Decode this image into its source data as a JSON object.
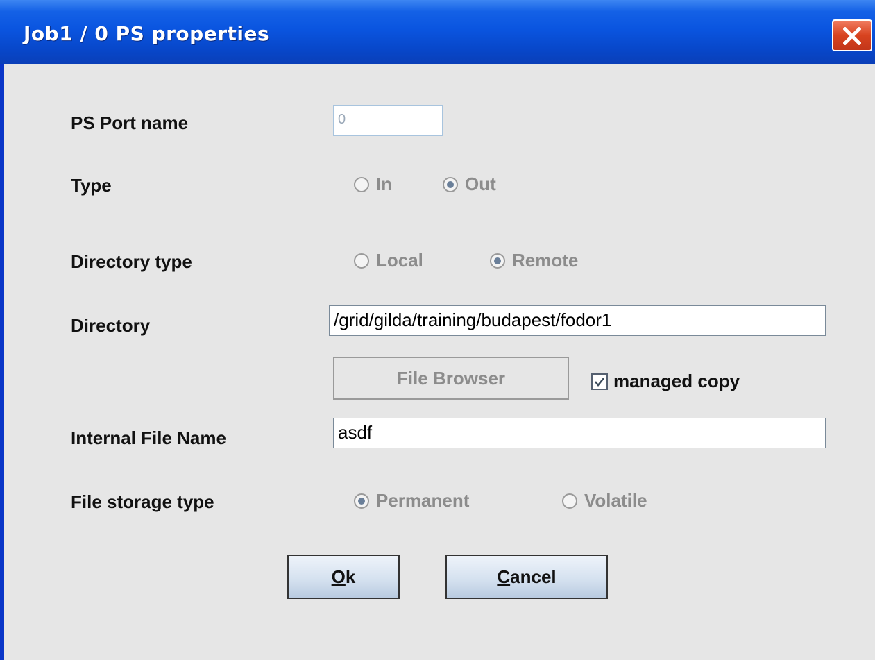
{
  "window": {
    "title": "Job1 / 0 PS properties"
  },
  "form": {
    "port_name": {
      "label": "PS Port name",
      "value": "0"
    },
    "type": {
      "label": "Type",
      "options": [
        "In",
        "Out"
      ],
      "selected": "Out"
    },
    "directory_type": {
      "label": "Directory type",
      "options": [
        "Local",
        "Remote"
      ],
      "selected": "Remote"
    },
    "directory": {
      "label": "Directory",
      "value": "/grid/gilda/training/budapest/fodor1"
    },
    "file_browser": {
      "label": "File Browser"
    },
    "managed_copy": {
      "label": "managed copy",
      "checked": true
    },
    "internal_file_name": {
      "label": "Internal File Name",
      "value": "asdf"
    },
    "file_storage_type": {
      "label": "File storage type",
      "options": [
        "Permanent",
        "Volatile"
      ],
      "selected": "Permanent"
    }
  },
  "buttons": {
    "ok": {
      "mnemonic": "O",
      "rest": "k"
    },
    "cancel": {
      "mnemonic": "C",
      "rest": "ancel"
    }
  },
  "colors": {
    "titlebar": "#0a55e0",
    "close_button": "#d8431f",
    "dialog_background": "#e6e6e6"
  }
}
